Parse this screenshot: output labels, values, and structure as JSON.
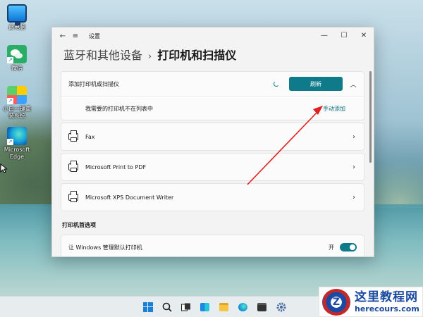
{
  "desktop": {
    "icons": [
      {
        "label": "此电脑",
        "icon": "computer-icon"
      },
      {
        "label": "微信",
        "icon": "wechat-icon"
      },
      {
        "label": "小白一键重装系统",
        "icon": "tool-icon"
      },
      {
        "label": "Microsoft Edge",
        "icon": "edge-icon"
      }
    ]
  },
  "window": {
    "title": "设置",
    "back_glyph": "←",
    "menu_glyph": "≡",
    "min_glyph": "—",
    "max_glyph": "☐",
    "close_glyph": "✕"
  },
  "breadcrumb": {
    "parent": "蓝牙和其他设备",
    "separator": "›",
    "current": "打印机和扫描仪"
  },
  "add_section": {
    "label": "添加打印机或扫描仪",
    "refresh_label": "刷新",
    "chevron": "︿",
    "not_listed_text": "我需要的打印机不在列表中",
    "manual_add_label": "手动添加"
  },
  "printers": [
    {
      "name": "Fax"
    },
    {
      "name": "Microsoft Print to PDF"
    },
    {
      "name": "Microsoft XPS Document Writer"
    }
  ],
  "chevron_right": "›",
  "preferences": {
    "title": "打印机首选项",
    "manage_default_label": "让 Windows 管理默认打印机",
    "manage_default_state": "开",
    "manage_default_on": true
  },
  "taskbar": {
    "apps": [
      "start-icon",
      "search-icon",
      "task-view-icon",
      "widgets-icon",
      "file-explorer-icon",
      "edge-icon",
      "store-icon",
      "settings-icon"
    ]
  },
  "watermark": {
    "logo_letter": "Z",
    "title": "这里教程网",
    "url": "herecours.com"
  },
  "colors": {
    "accent": "#0e7a8a",
    "annotation": "#e02020"
  }
}
